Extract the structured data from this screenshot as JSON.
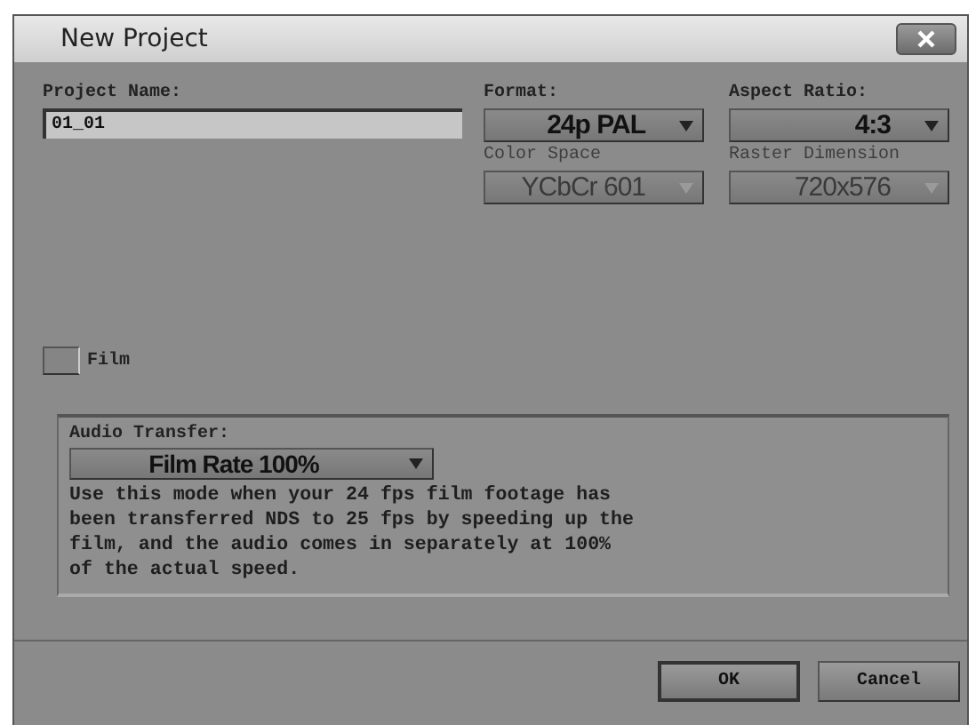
{
  "window": {
    "title": "New Project"
  },
  "project_name": {
    "label": "Project Name:",
    "value": "01_01"
  },
  "dropdowns": [
    {
      "label": "Format:",
      "value": "24p PAL",
      "disabled": false
    },
    {
      "label": "Aspect Ratio:",
      "value": "4:3",
      "disabled": false
    },
    {
      "label": "Color Space",
      "value": "YCbCr 601",
      "disabled": true
    },
    {
      "label": "Raster Dimension",
      "value": "720x576",
      "disabled": true
    }
  ],
  "film": {
    "label": "Film",
    "checked": false
  },
  "audio_transfer": {
    "label": "Audio Transfer:",
    "value": "Film Rate 100%",
    "description": "Use this mode when your 24 fps film footage has been transferred NDS to 25 fps by speeding up the film, and the audio comes in separately at 100% of the actual speed."
  },
  "buttons": [
    "OK",
    "Cancel"
  ]
}
